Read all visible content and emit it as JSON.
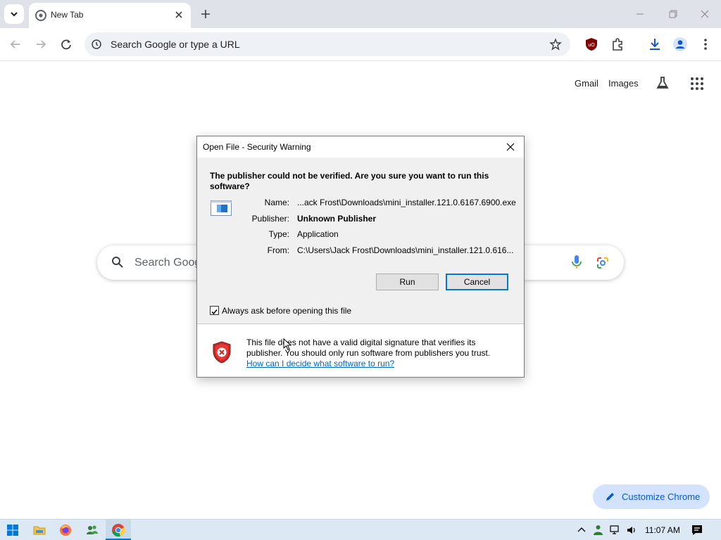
{
  "browser": {
    "tab_title": "New Tab",
    "omnibox_placeholder": "Search Google or type a URL"
  },
  "ntp": {
    "gmail": "Gmail",
    "images": "Images",
    "search_placeholder": "Search Goog",
    "customize_label": "Customize Chrome"
  },
  "dialog": {
    "title": "Open File - Security Warning",
    "question": "The publisher could not be verified.  Are you sure you want to run this software?",
    "fields": [
      {
        "label": "Name:",
        "value": "...ack Frost\\Downloads\\mini_installer.121.0.6167.6900.exe",
        "bold": false
      },
      {
        "label": "Publisher:",
        "value": "Unknown Publisher",
        "bold": true
      },
      {
        "label": "Type:",
        "value": "Application",
        "bold": false
      },
      {
        "label": "From:",
        "value": "C:\\Users\\Jack Frost\\Downloads\\mini_installer.121.0.616...",
        "bold": false
      }
    ],
    "run_label": "Run",
    "cancel_label": "Cancel",
    "checkbox_label": "Always ask before opening this file",
    "checkbox_checked": true,
    "warning_text": "This file does not have a valid digital signature that verifies its publisher.  You should only run software from publishers you trust.",
    "help_link": "How can I decide what software to run?"
  },
  "taskbar": {
    "clock": "11:07 AM"
  }
}
